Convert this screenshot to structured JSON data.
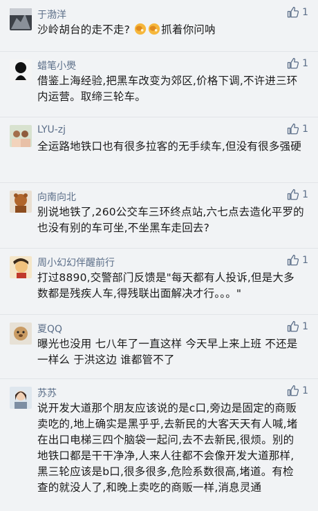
{
  "comments": [
    {
      "user": "于渤洋",
      "likes": "1",
      "text_before": "沙岭胡台的走不走?",
      "text_after": "抓着你问呐",
      "emoji": [
        "thumb-fox-emoji",
        "thumb-fox-emoji"
      ]
    },
    {
      "user": "蜡笔小爂",
      "likes": "1",
      "text": "借鉴上海经验,把黑车改变为郊区,价格下调,不许进三环内运营。取缔三轮车。"
    },
    {
      "user": "LYU-zj",
      "likes": "1",
      "text": "全运路地铁口也有很多拉客的无手续车,但没有很多强硬"
    },
    {
      "user": "向南向北",
      "likes": "1",
      "text": "别说地铁了,260公交车三环终点站,六七点去造化平罗的也没有别的车可坐,不坐黑车走回去?"
    },
    {
      "user": "周小幻幻伴醒前行",
      "likes": "1",
      "text": "打过8890,交警部门反馈是\"每天都有人投诉,但是大多数都是残疾人车,得残联出面解决才行。。。\""
    },
    {
      "user": "夏QQ",
      "likes": "1",
      "text": "曝光也没用 七八年了一直这样 今天早上来上班 不还是一样么 于洪这边 谁都管不了"
    },
    {
      "user": "苏苏",
      "likes": "1",
      "text": "说开发大道那个朋友应该说的是c口,旁边是固定的商贩卖吃的,地上确实是黑乎乎,去新民的大客天天有人喊,堵在出口电梯三四个脑袋一起问,去不去新民,很烦。别的地铁口都是干干净净,人来人往都不会像开发大道那样,黑三轮应该是b口,很多很多,危险系数很高,堵道。有检查的就没人了,和晚上卖吃的商贩一样,消息灵通"
    }
  ],
  "colors": {
    "name": "#5b6e88",
    "text": "#1a1a1a",
    "background": "#f1f3f5",
    "divider": "#e1e4e8"
  }
}
